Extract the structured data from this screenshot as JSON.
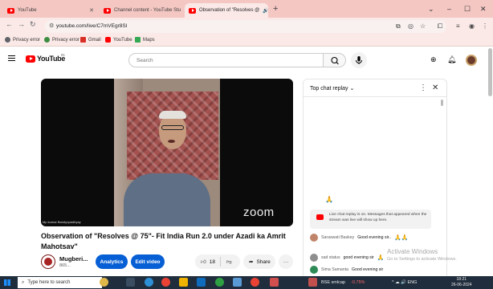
{
  "browser": {
    "tabs": [
      {
        "title": "YouTube",
        "active": false
      },
      {
        "title": "Channel content - YouTube Stu",
        "active": false
      },
      {
        "title": "Observation of \"Resolves @",
        "active": true
      }
    ],
    "new_tab": "+",
    "window_controls": [
      "⌄",
      "–",
      "☐",
      "✕"
    ],
    "url": "youtube.com/live/C7mVEgr8SI",
    "bookmarks": [
      "Privacy error",
      "Privacy error",
      "Gmail",
      "YouTube",
      "Maps"
    ]
  },
  "masthead": {
    "logo_text": "YouTube",
    "country": "IN",
    "search_placeholder": "Search"
  },
  "video": {
    "camera_label": "Mp kumar Bandyopadhyay",
    "zoom_text": "zoom",
    "title": "Observation of \"Resolves @ 75\"- Fit India Run 2.0 under Azadi ka Amrit Mahotsav\"",
    "channel_name": "Mugberi...",
    "subscribers": "865...",
    "analytics_label": "Analytics",
    "edit_label": "Edit video",
    "likes": "18",
    "share_label": "Share",
    "more": "···"
  },
  "chat": {
    "header": "Top chat replay",
    "notice": "Live chat replay is on. Messages that appeared when the stream was live will show up here.",
    "emoji_row": "🙏",
    "messages": [
      {
        "author": "Saraswati Baskey",
        "text": "Good evening sir..",
        "emoji": "🙏🙏",
        "color": "#c0846b"
      },
      {
        "author": "sad status",
        "text": "good evening sir",
        "emoji": "🙏",
        "color": "#8e8e8e"
      },
      {
        "author": "Sima Samanta",
        "text": "Good evening sir",
        "emoji": "",
        "color": "#2e8b57"
      }
    ]
  },
  "watermark": {
    "title": "Activate Windows",
    "subtitle": "Go to Settings to activate Windows."
  },
  "taskbar": {
    "search_placeholder": "Type here to search",
    "stock_label": "BSE smlcap",
    "stock_change": "-0.75%",
    "tray": "^ ☁ 🔊 ENG",
    "time": "18:21",
    "date": "26-06-2024"
  }
}
